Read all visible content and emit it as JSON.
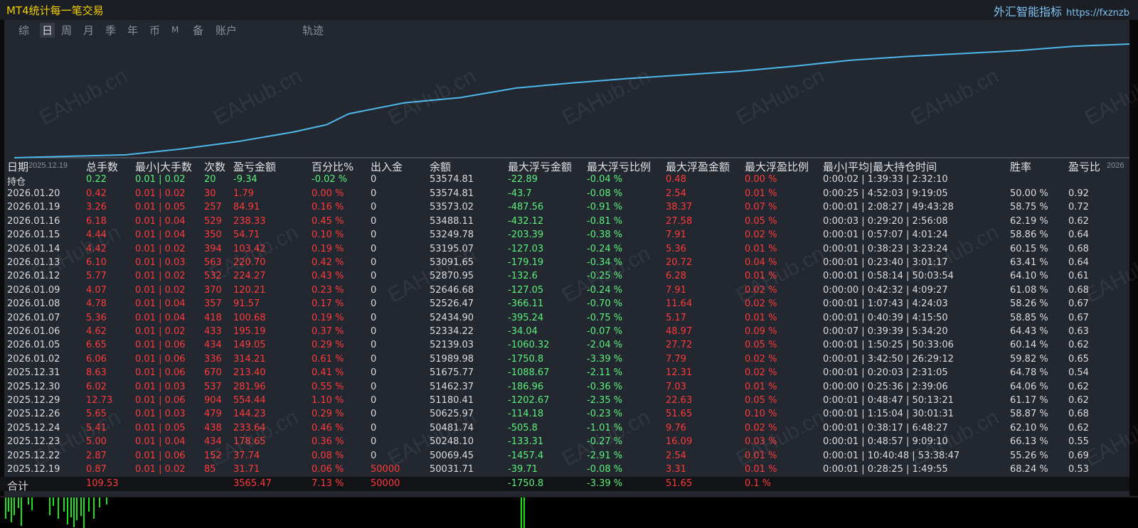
{
  "app_title": "MT4统计每一笔交易",
  "brand": {
    "name": "外汇智能指标",
    "url": "https://fxznzb"
  },
  "tabs": [
    {
      "label": "综",
      "active": false
    },
    {
      "label": "日",
      "active": true
    },
    {
      "label": "周",
      "active": false
    },
    {
      "label": "月",
      "active": false
    },
    {
      "label": "季",
      "active": false
    },
    {
      "label": "年",
      "active": false
    },
    {
      "label": "币",
      "active": false
    },
    {
      "label": "M",
      "active": false
    },
    {
      "label": "备",
      "active": false
    },
    {
      "label": "账户",
      "active": false
    },
    {
      "label": "轨迹",
      "active": false
    }
  ],
  "watermark": "EAHub.cn",
  "chart_data": {
    "type": "line",
    "x_start_label": "2025.12.19",
    "x_end_label": "2026",
    "color": "#4fb8ea",
    "points": [
      [
        0,
        0
      ],
      [
        0.05,
        0.02
      ],
      [
        0.1,
        0.04
      ],
      [
        0.15,
        0.12
      ],
      [
        0.2,
        0.22
      ],
      [
        0.25,
        0.35
      ],
      [
        0.28,
        0.45
      ],
      [
        0.3,
        0.6
      ],
      [
        0.35,
        0.75
      ],
      [
        0.4,
        0.82
      ],
      [
        0.45,
        0.95
      ],
      [
        0.5,
        1.02
      ],
      [
        0.55,
        1.08
      ],
      [
        0.6,
        1.13
      ],
      [
        0.65,
        1.18
      ],
      [
        0.7,
        1.25
      ],
      [
        0.75,
        1.33
      ],
      [
        0.8,
        1.38
      ],
      [
        0.85,
        1.42
      ],
      [
        0.9,
        1.46
      ],
      [
        0.95,
        1.52
      ],
      [
        1,
        1.55
      ]
    ]
  },
  "columns": [
    "日期",
    "总手数",
    "最小|大手数",
    "次数",
    "盈亏金额",
    "百分比%",
    "出入金",
    "余额",
    "最大浮亏金额",
    "最大浮亏比例",
    "最大浮盈金额",
    "最大浮盈比例",
    "最小|平均|最大持仓时间",
    "胜率",
    "盈亏比"
  ],
  "holding": {
    "date": "持仓",
    "lots": "0.22",
    "minmax": "0.01 | 0.02",
    "count": "20",
    "pnl": "-9.34",
    "pct": "-0.02 %",
    "flow": "0",
    "balance": "53574.81",
    "max_dd": "-22.89",
    "max_dd_pct": "-0.04 %",
    "max_fp": "0.48",
    "max_fp_pct": "0.00 %",
    "hold_time": "0:00:02 | 1:39:33 | 2:32:10",
    "win": "",
    "ratio": ""
  },
  "rows": [
    {
      "date": "2026.01.20",
      "lots": "0.42",
      "minmax": "0.01 | 0.02",
      "count": "30",
      "pnl": "1.79",
      "pct": "0.00 %",
      "flow": "0",
      "balance": "53574.81",
      "max_dd": "-43.7",
      "max_dd_pct": "-0.08 %",
      "max_fp": "2.54",
      "max_fp_pct": "0.01 %",
      "hold_time": "0:00:25 | 4:52:03 | 9:19:05",
      "win": "50.00 %",
      "ratio": "0.92"
    },
    {
      "date": "2026.01.19",
      "lots": "3.26",
      "minmax": "0.01 | 0.05",
      "count": "257",
      "pnl": "84.91",
      "pct": "0.16 %",
      "flow": "0",
      "balance": "53573.02",
      "max_dd": "-487.56",
      "max_dd_pct": "-0.91 %",
      "max_fp": "38.37",
      "max_fp_pct": "0.07 %",
      "hold_time": "0:00:01 | 2:08:27 | 49:43:28",
      "win": "58.75 %",
      "ratio": "0.72"
    },
    {
      "date": "2026.01.16",
      "lots": "6.18",
      "minmax": "0.01 | 0.04",
      "count": "529",
      "pnl": "238.33",
      "pct": "0.45 %",
      "flow": "0",
      "balance": "53488.11",
      "max_dd": "-432.12",
      "max_dd_pct": "-0.81 %",
      "max_fp": "27.58",
      "max_fp_pct": "0.05 %",
      "hold_time": "0:00:03 | 0:29:20 | 2:56:08",
      "win": "62.19 %",
      "ratio": "0.62"
    },
    {
      "date": "2026.01.15",
      "lots": "4.44",
      "minmax": "0.01 | 0.04",
      "count": "350",
      "pnl": "54.71",
      "pct": "0.10 %",
      "flow": "0",
      "balance": "53249.78",
      "max_dd": "-203.39",
      "max_dd_pct": "-0.38 %",
      "max_fp": "7.91",
      "max_fp_pct": "0.02 %",
      "hold_time": "0:00:01 | 0:57:07 | 4:01:24",
      "win": "58.86 %",
      "ratio": "0.64"
    },
    {
      "date": "2026.01.14",
      "lots": "4.42",
      "minmax": "0.01 | 0.02",
      "count": "394",
      "pnl": "103.42",
      "pct": "0.19 %",
      "flow": "0",
      "balance": "53195.07",
      "max_dd": "-127.03",
      "max_dd_pct": "-0.24 %",
      "max_fp": "5.36",
      "max_fp_pct": "0.01 %",
      "hold_time": "0:00:01 | 0:38:23 | 3:23:24",
      "win": "60.15 %",
      "ratio": "0.68"
    },
    {
      "date": "2026.01.13",
      "lots": "6.10",
      "minmax": "0.01 | 0.03",
      "count": "563",
      "pnl": "220.70",
      "pct": "0.42 %",
      "flow": "0",
      "balance": "53091.65",
      "max_dd": "-179.19",
      "max_dd_pct": "-0.34 %",
      "max_fp": "20.72",
      "max_fp_pct": "0.04 %",
      "hold_time": "0:00:01 | 0:23:40 | 3:01:17",
      "win": "63.41 %",
      "ratio": "0.64"
    },
    {
      "date": "2026.01.12",
      "lots": "5.77",
      "minmax": "0.01 | 0.02",
      "count": "532",
      "pnl": "224.27",
      "pct": "0.43 %",
      "flow": "0",
      "balance": "52870.95",
      "max_dd": "-132.6",
      "max_dd_pct": "-0.25 %",
      "max_fp": "6.28",
      "max_fp_pct": "0.01 %",
      "hold_time": "0:00:01 | 0:58:14 | 50:03:54",
      "win": "64.10 %",
      "ratio": "0.61"
    },
    {
      "date": "2026.01.09",
      "lots": "4.07",
      "minmax": "0.01 | 0.02",
      "count": "370",
      "pnl": "120.21",
      "pct": "0.23 %",
      "flow": "0",
      "balance": "52646.68",
      "max_dd": "-127.05",
      "max_dd_pct": "-0.24 %",
      "max_fp": "7.91",
      "max_fp_pct": "0.02 %",
      "hold_time": "0:00:00 | 0:42:32 | 4:09:27",
      "win": "61.08 %",
      "ratio": "0.68"
    },
    {
      "date": "2026.01.08",
      "lots": "4.78",
      "minmax": "0.01 | 0.04",
      "count": "357",
      "pnl": "91.57",
      "pct": "0.17 %",
      "flow": "0",
      "balance": "52526.47",
      "max_dd": "-366.11",
      "max_dd_pct": "-0.70 %",
      "max_fp": "11.64",
      "max_fp_pct": "0.02 %",
      "hold_time": "0:00:01 | 1:07:43 | 4:24:03",
      "win": "58.26 %",
      "ratio": "0.67"
    },
    {
      "date": "2026.01.07",
      "lots": "5.36",
      "minmax": "0.01 | 0.04",
      "count": "418",
      "pnl": "100.68",
      "pct": "0.19 %",
      "flow": "0",
      "balance": "52434.90",
      "max_dd": "-395.24",
      "max_dd_pct": "-0.75 %",
      "max_fp": "5.17",
      "max_fp_pct": "0.01 %",
      "hold_time": "0:00:01 | 0:40:39 | 4:15:50",
      "win": "58.85 %",
      "ratio": "0.67"
    },
    {
      "date": "2026.01.06",
      "lots": "4.62",
      "minmax": "0.01 | 0.02",
      "count": "433",
      "pnl": "195.19",
      "pct": "0.37 %",
      "flow": "0",
      "balance": "52334.22",
      "max_dd": "-34.04",
      "max_dd_pct": "-0.07 %",
      "max_fp": "48.97",
      "max_fp_pct": "0.09 %",
      "hold_time": "0:00:07 | 0:39:39 | 5:34:20",
      "win": "64.43 %",
      "ratio": "0.63"
    },
    {
      "date": "2026.01.05",
      "lots": "6.65",
      "minmax": "0.01 | 0.06",
      "count": "434",
      "pnl": "149.05",
      "pct": "0.29 %",
      "flow": "0",
      "balance": "52139.03",
      "max_dd": "-1060.32",
      "max_dd_pct": "-2.04 %",
      "max_fp": "27.72",
      "max_fp_pct": "0.05 %",
      "hold_time": "0:00:01 | 1:50:25 | 50:33:06",
      "win": "60.14 %",
      "ratio": "0.62"
    },
    {
      "date": "2026.01.02",
      "lots": "6.06",
      "minmax": "0.01 | 0.06",
      "count": "336",
      "pnl": "314.21",
      "pct": "0.61 %",
      "flow": "0",
      "balance": "51989.98",
      "max_dd": "-1750.8",
      "max_dd_pct": "-3.39 %",
      "max_fp": "7.79",
      "max_fp_pct": "0.02 %",
      "hold_time": "0:00:01 | 3:42:50 | 26:29:12",
      "win": "59.82 %",
      "ratio": "0.65"
    },
    {
      "date": "2025.12.31",
      "lots": "8.63",
      "minmax": "0.01 | 0.06",
      "count": "670",
      "pnl": "213.40",
      "pct": "0.41 %",
      "flow": "0",
      "balance": "51675.77",
      "max_dd": "-1088.67",
      "max_dd_pct": "-2.11 %",
      "max_fp": "12.31",
      "max_fp_pct": "0.02 %",
      "hold_time": "0:00:01 | 0:20:03 | 2:31:05",
      "win": "64.78 %",
      "ratio": "0.54"
    },
    {
      "date": "2025.12.30",
      "lots": "6.02",
      "minmax": "0.01 | 0.03",
      "count": "537",
      "pnl": "281.96",
      "pct": "0.55 %",
      "flow": "0",
      "balance": "51462.37",
      "max_dd": "-186.96",
      "max_dd_pct": "-0.36 %",
      "max_fp": "7.03",
      "max_fp_pct": "0.01 %",
      "hold_time": "0:00:00 | 0:25:36 | 2:39:06",
      "win": "64.06 %",
      "ratio": "0.62"
    },
    {
      "date": "2025.12.29",
      "lots": "12.73",
      "minmax": "0.01 | 0.06",
      "count": "904",
      "pnl": "554.44",
      "pct": "1.10 %",
      "flow": "0",
      "balance": "51180.41",
      "max_dd": "-1202.67",
      "max_dd_pct": "-2.35 %",
      "max_fp": "22.63",
      "max_fp_pct": "0.05 %",
      "hold_time": "0:00:01 | 0:48:47 | 50:13:21",
      "win": "61.17 %",
      "ratio": "0.62"
    },
    {
      "date": "2025.12.26",
      "lots": "5.65",
      "minmax": "0.01 | 0.03",
      "count": "479",
      "pnl": "144.23",
      "pct": "0.29 %",
      "flow": "0",
      "balance": "50625.97",
      "max_dd": "-114.18",
      "max_dd_pct": "-0.23 %",
      "max_fp": "51.65",
      "max_fp_pct": "0.10 %",
      "hold_time": "0:00:01 | 1:15:04 | 30:01:31",
      "win": "58.87 %",
      "ratio": "0.68"
    },
    {
      "date": "2025.12.24",
      "lots": "5.41",
      "minmax": "0.01 | 0.05",
      "count": "438",
      "pnl": "233.64",
      "pct": "0.46 %",
      "flow": "0",
      "balance": "50481.74",
      "max_dd": "-505.8",
      "max_dd_pct": "-1.01 %",
      "max_fp": "9.76",
      "max_fp_pct": "0.02 %",
      "hold_time": "0:00:01 | 0:38:17 | 6:48:27",
      "win": "62.10 %",
      "ratio": "0.62"
    },
    {
      "date": "2025.12.23",
      "lots": "5.00",
      "minmax": "0.01 | 0.04",
      "count": "434",
      "pnl": "178.65",
      "pct": "0.36 %",
      "flow": "0",
      "balance": "50248.10",
      "max_dd": "-133.31",
      "max_dd_pct": "-0.27 %",
      "max_fp": "16.09",
      "max_fp_pct": "0.03 %",
      "hold_time": "0:00:01 | 0:48:57 | 9:09:10",
      "win": "66.13 %",
      "ratio": "0.55"
    },
    {
      "date": "2025.12.22",
      "lots": "2.87",
      "minmax": "0.01 | 0.06",
      "count": "152",
      "pnl": "37.74",
      "pct": "0.08 %",
      "flow": "0",
      "balance": "50069.45",
      "max_dd": "-1457.4",
      "max_dd_pct": "-2.91 %",
      "max_fp": "2.54",
      "max_fp_pct": "0.01 %",
      "hold_time": "0:00:01 | 10:40:48 | 53:38:47",
      "win": "55.26 %",
      "ratio": "0.69"
    },
    {
      "date": "2025.12.19",
      "lots": "0.87",
      "minmax": "0.01 | 0.02",
      "count": "85",
      "pnl": "31.71",
      "pct": "0.06 %",
      "flow": "50000",
      "balance": "50031.71",
      "max_dd": "-39.71",
      "max_dd_pct": "-0.08 %",
      "max_fp": "3.31",
      "max_fp_pct": "0.01 %",
      "hold_time": "0:00:01 | 0:28:25 | 1:49:55",
      "win": "68.24 %",
      "ratio": "0.53"
    }
  ],
  "total": {
    "date": "合计",
    "lots": "109.53",
    "minmax": "",
    "count": "",
    "pnl": "3565.47",
    "pct": "7.13 %",
    "flow": "50000",
    "balance": "",
    "max_dd": "-1750.8",
    "max_dd_pct": "-3.39 %",
    "max_fp": "51.65",
    "max_fp_pct": "0.1 %",
    "hold_time": "",
    "win": "",
    "ratio": ""
  },
  "colors": {
    "accent_title": "#f4d000",
    "brand": "#7fc1ee",
    "positive": "#ff3a3a",
    "negative": "#5cf07c",
    "line": "#4fb8ea"
  }
}
